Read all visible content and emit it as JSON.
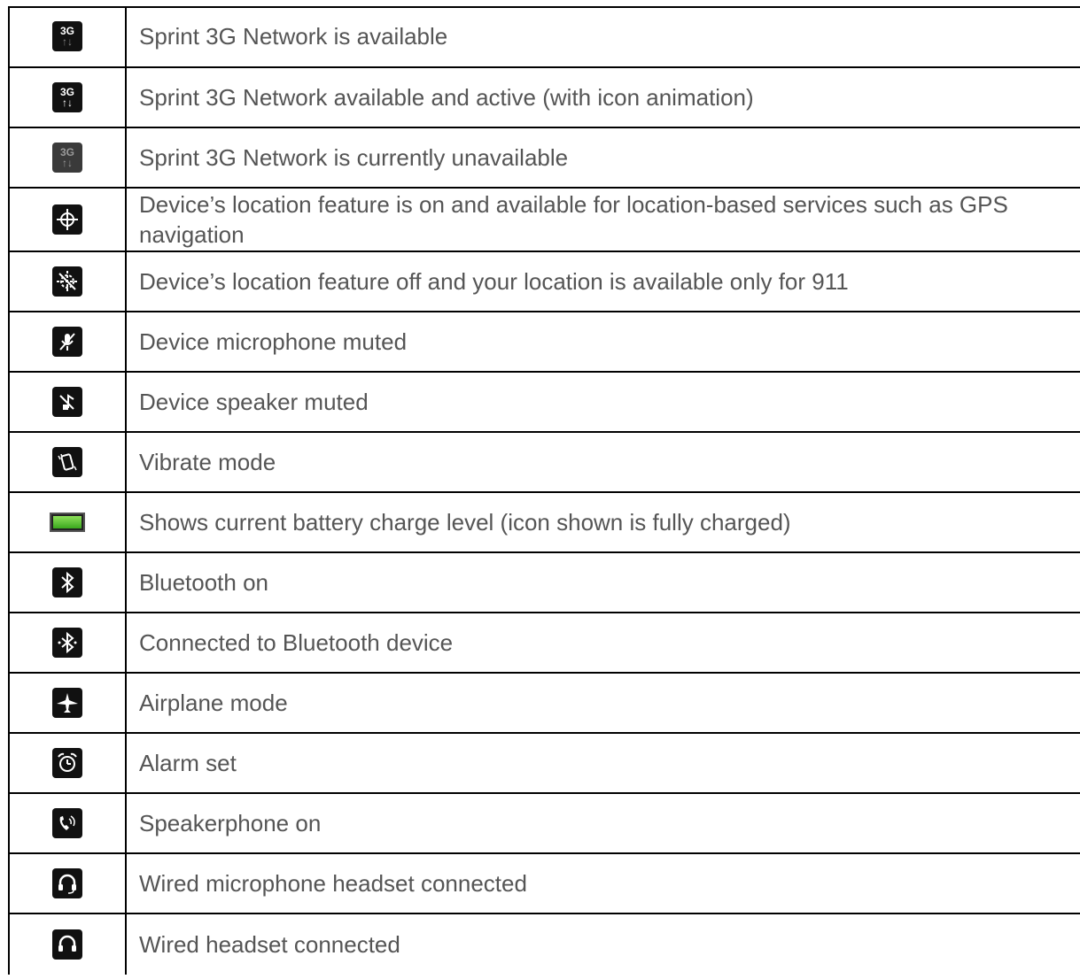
{
  "rows": [
    {
      "icon": "3g-available-icon",
      "text": "Sprint 3G Network is available"
    },
    {
      "icon": "3g-active-icon",
      "text": "Sprint 3G Network available and active (with icon animation)"
    },
    {
      "icon": "3g-unavailable-icon",
      "text": "Sprint 3G Network is currently unavailable"
    },
    {
      "icon": "location-on-icon",
      "text": "Device’s location feature is on and available for location-based services such as GPS navigation"
    },
    {
      "icon": "location-off-icon",
      "text": "Device’s location feature off and your location is available only for 911"
    },
    {
      "icon": "microphone-muted-icon",
      "text": "Device microphone muted"
    },
    {
      "icon": "speaker-muted-icon",
      "text": "Device speaker muted"
    },
    {
      "icon": "vibrate-icon",
      "text": "Vibrate mode"
    },
    {
      "icon": "battery-full-icon",
      "text": "Shows current battery charge level (icon shown is fully charged)"
    },
    {
      "icon": "bluetooth-on-icon",
      "text": "Bluetooth on"
    },
    {
      "icon": "bluetooth-connected-icon",
      "text": "Connected to Bluetooth device"
    },
    {
      "icon": "airplane-icon",
      "text": "Airplane mode"
    },
    {
      "icon": "alarm-icon",
      "text": "Alarm set"
    },
    {
      "icon": "speakerphone-icon",
      "text": "Speakerphone on"
    },
    {
      "icon": "headset-mic-icon",
      "text": "Wired microphone headset connected"
    },
    {
      "icon": "headset-icon",
      "text": "Wired headset connected"
    }
  ],
  "icon_labels": {
    "network": "3G",
    "arrows": "↑↓"
  }
}
